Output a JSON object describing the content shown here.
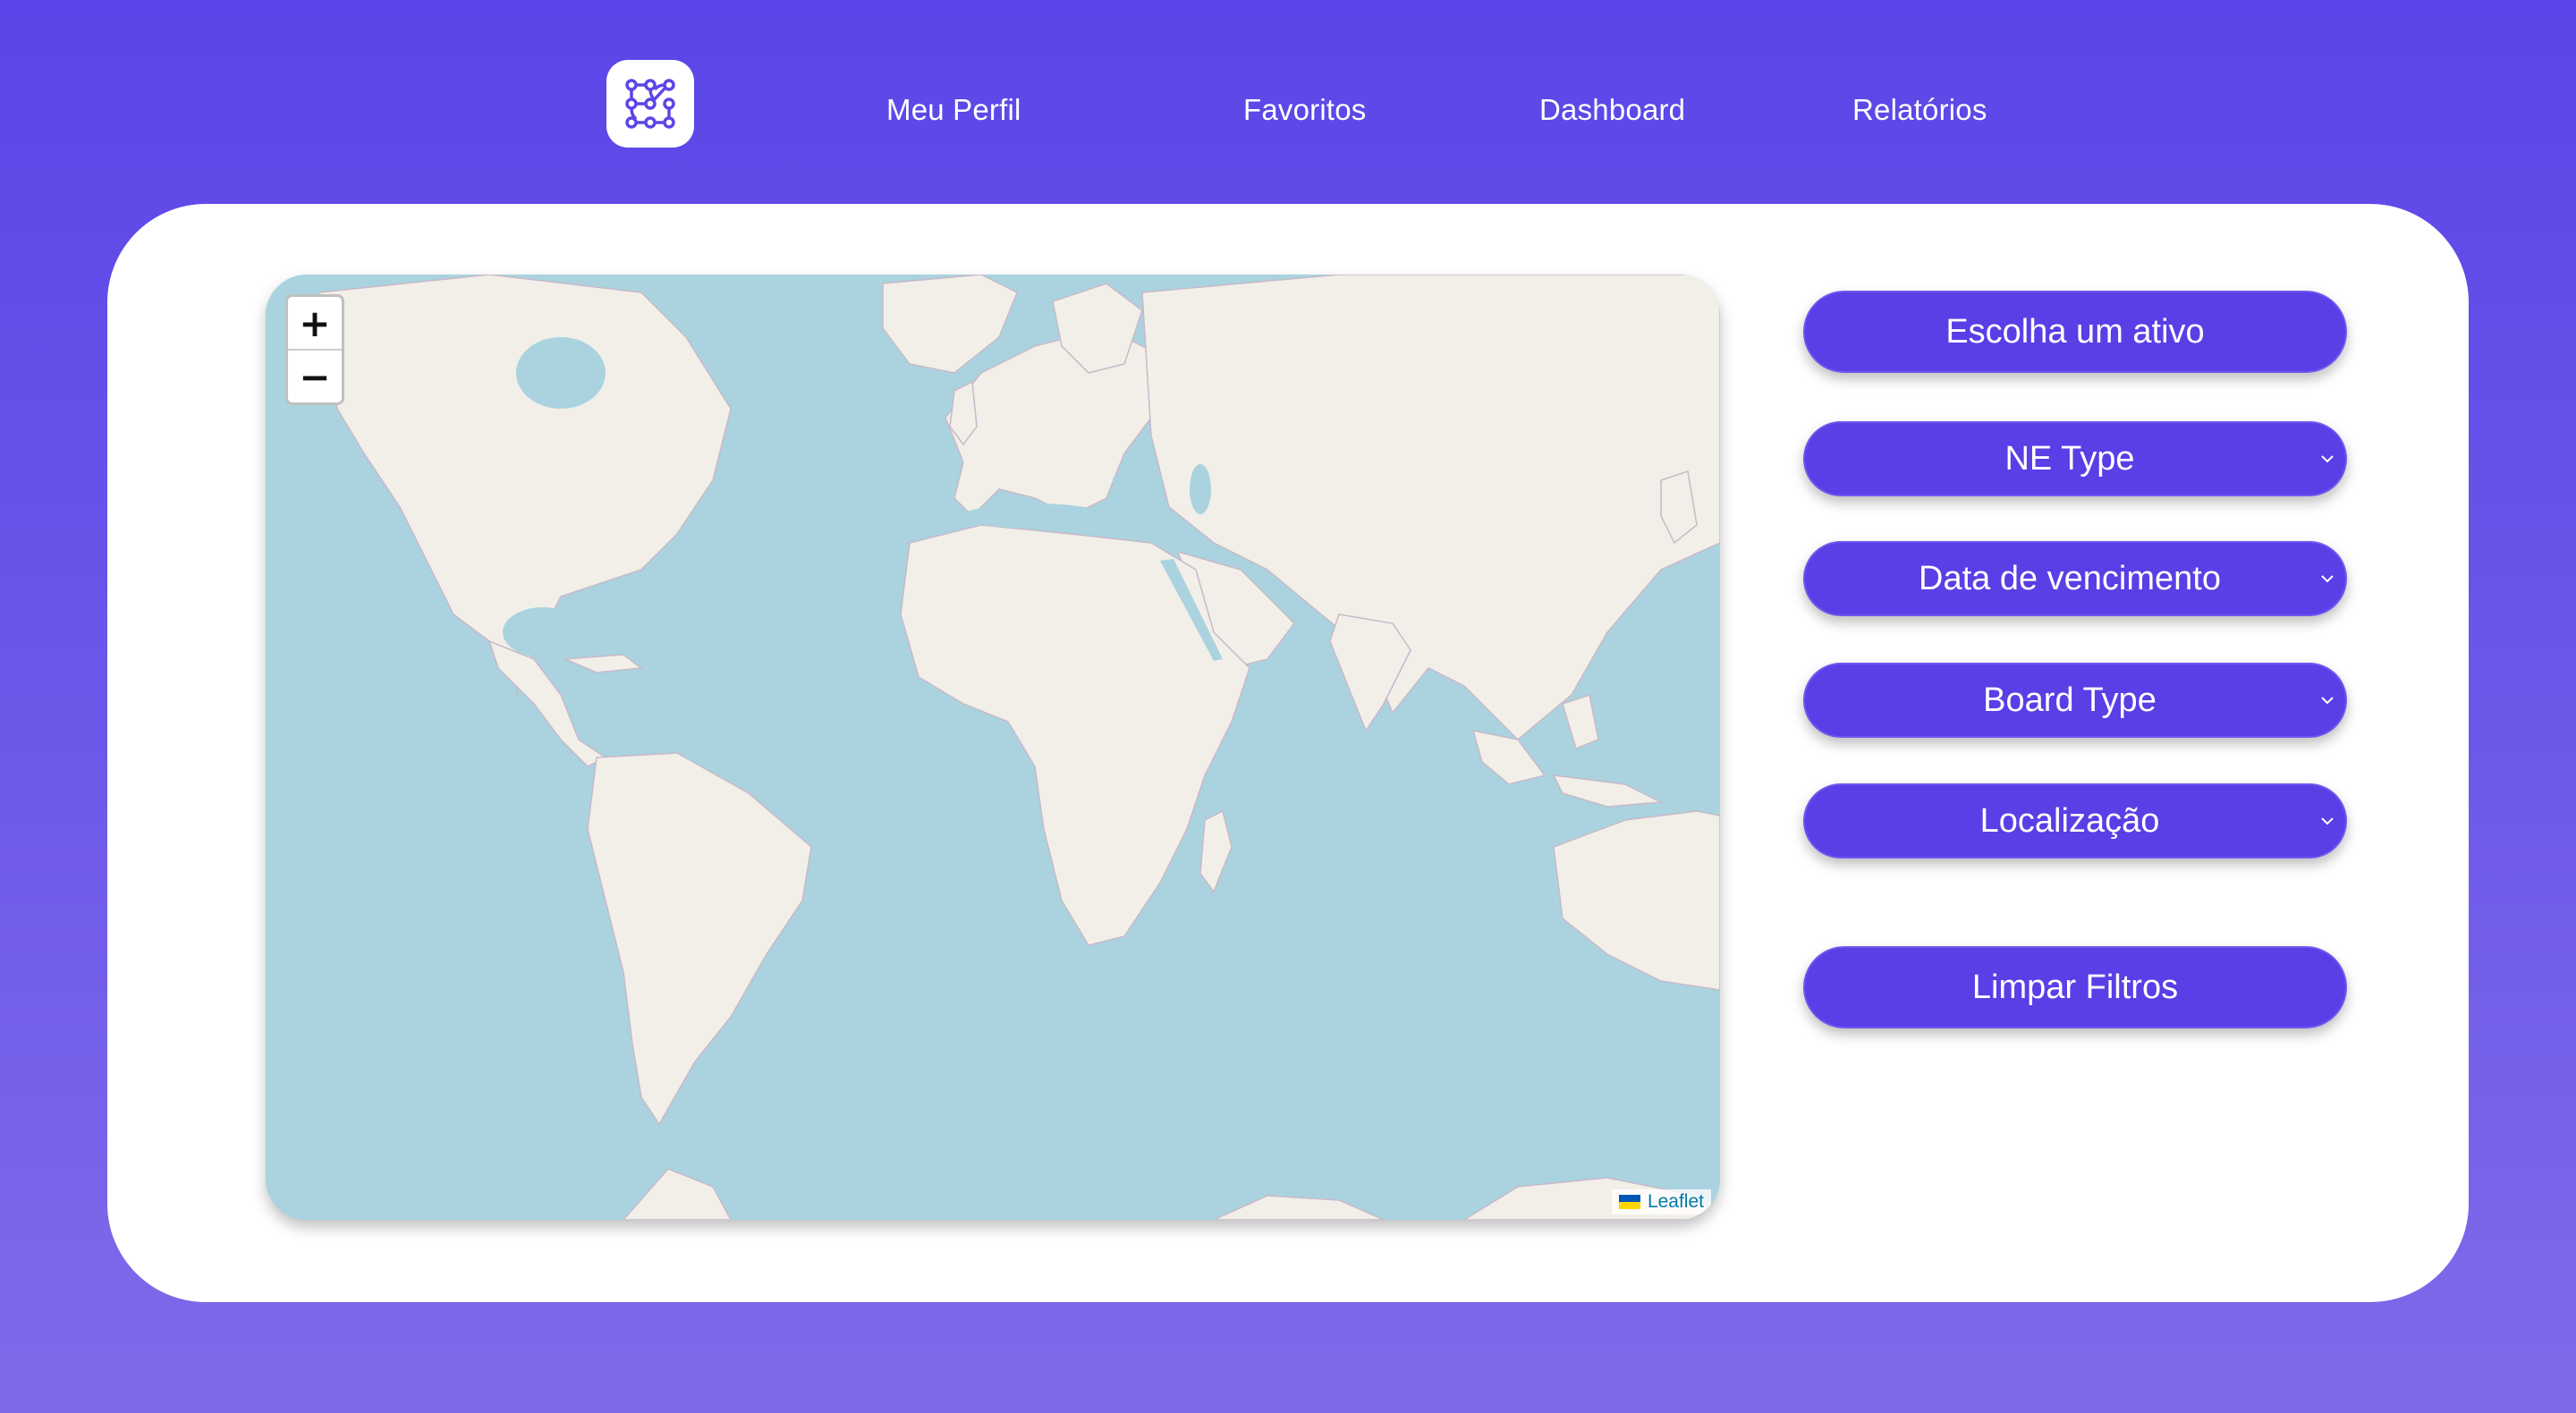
{
  "nav": {
    "logo_icon": "circuit-grid-icon",
    "links": [
      "Meu Perfil",
      "Favoritos",
      "Dashboard",
      "Relatórios"
    ]
  },
  "map": {
    "zoom_in": "+",
    "zoom_out": "−",
    "attribution": "Leaflet"
  },
  "filters": {
    "asset_button": "Escolha um ativo",
    "ne_type": "NE Type",
    "due_date": "Data de vencimento",
    "board_type": "Board Type",
    "location": "Localização",
    "clear_button": "Limpar Filtros"
  },
  "colors": {
    "brand": "#5b45e8",
    "button": "#5a3ee6",
    "ocean": "#aad3df",
    "land": "#f2efe9"
  }
}
